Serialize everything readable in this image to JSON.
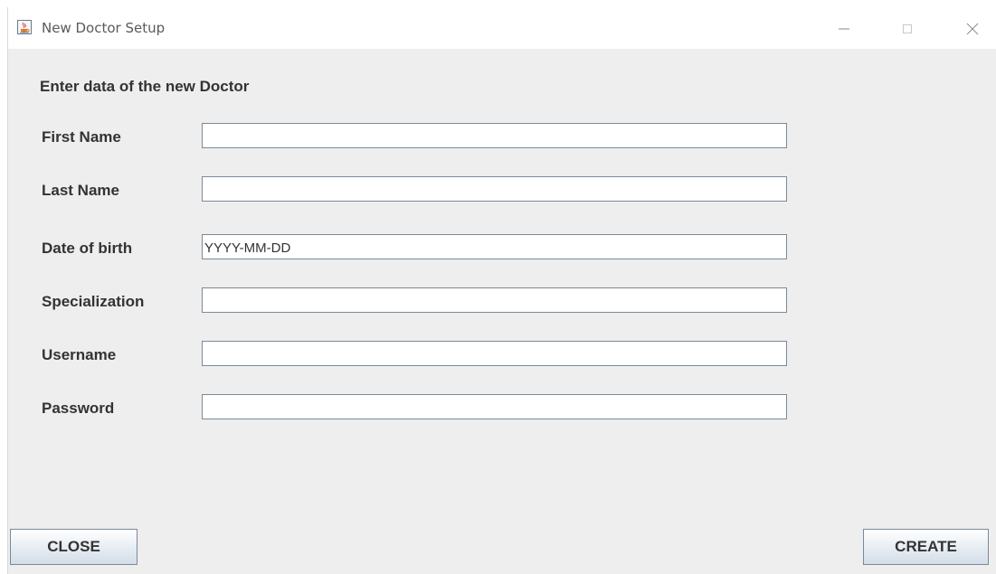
{
  "window": {
    "title": "New Doctor Setup",
    "icon": "java-cup-icon"
  },
  "form": {
    "heading": "Enter data of the new Doctor",
    "fields": [
      {
        "label": "First Name",
        "value": "",
        "placeholder": ""
      },
      {
        "label": "Last Name",
        "value": "",
        "placeholder": ""
      },
      {
        "label": "Date of birth",
        "value": "",
        "placeholder": "YYYY-MM-DD"
      },
      {
        "label": "Specialization",
        "value": "",
        "placeholder": ""
      },
      {
        "label": "Username",
        "value": "",
        "placeholder": ""
      },
      {
        "label": "Password",
        "value": "",
        "placeholder": ""
      }
    ]
  },
  "buttons": {
    "close_label": "CLOSE",
    "create_label": "CREATE"
  }
}
